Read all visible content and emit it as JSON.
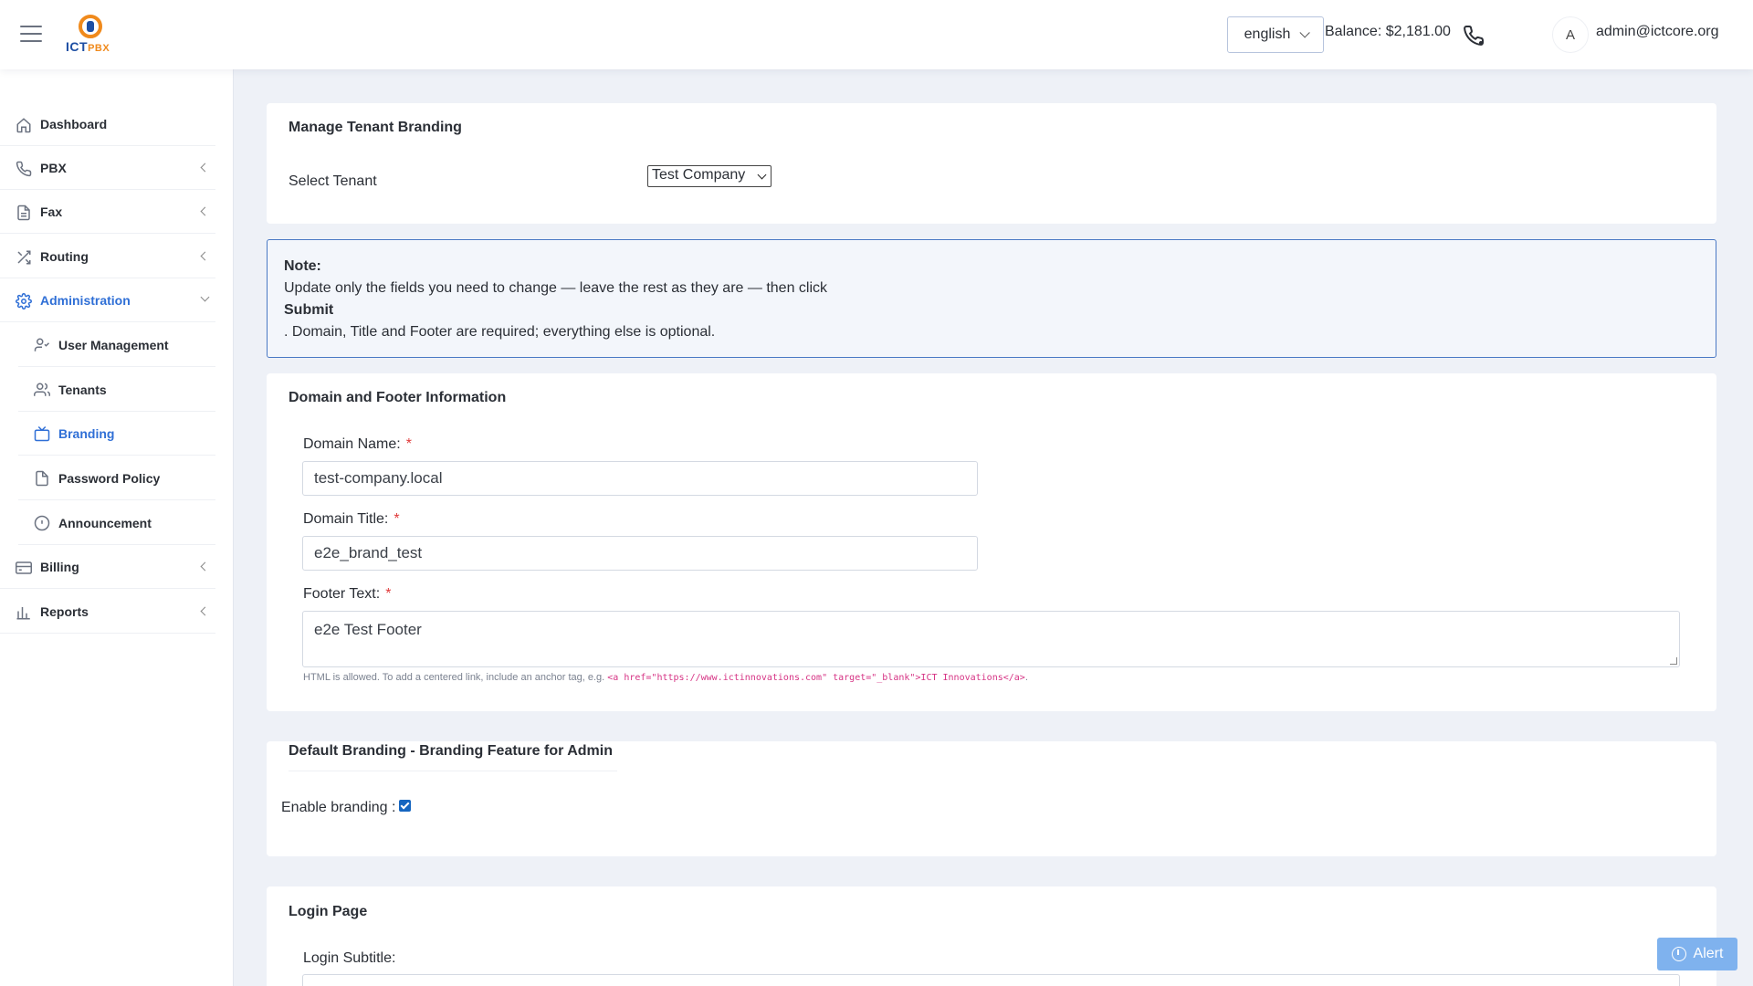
{
  "header": {
    "language": "english",
    "balance": "Balance: $2,181.00",
    "avatar_initial": "A",
    "user_email": "admin@ictcore.org",
    "logo_text": "ICT",
    "logo_suffix": "PBX"
  },
  "sidebar": {
    "items": [
      {
        "label": "Dashboard",
        "icon": "home-icon"
      },
      {
        "label": "PBX",
        "icon": "phone-icon"
      },
      {
        "label": "Fax",
        "icon": "document-icon"
      },
      {
        "label": "Routing",
        "icon": "shuffle-icon"
      },
      {
        "label": "Administration",
        "icon": "gear-icon"
      },
      {
        "label": "Billing",
        "icon": "credit-card-icon"
      },
      {
        "label": "Reports",
        "icon": "bar-chart-icon"
      }
    ],
    "admin_subitems": [
      {
        "label": "User Management",
        "icon": "user-check-icon"
      },
      {
        "label": "Tenants",
        "icon": "users-icon"
      },
      {
        "label": "Branding",
        "icon": "tv-icon"
      },
      {
        "label": "Password Policy",
        "icon": "file-icon"
      },
      {
        "label": "Announcement",
        "icon": "info-icon"
      }
    ]
  },
  "manage": {
    "title": "Manage Tenant Branding",
    "tenant_label": "Select Tenant",
    "tenant_value": "Test Company"
  },
  "note": {
    "heading": "Note:",
    "line1": "Update only the fields you need to change — leave the rest as they are — then click",
    "submit": "Submit",
    "line3": ". Domain, Title and Footer are required; everything else is optional."
  },
  "domain_section": {
    "title": "Domain and Footer Information",
    "domain_name_label": "Domain Name:",
    "domain_name_value": "test-company.local",
    "domain_title_label": "Domain Title:",
    "domain_title_value": "e2e_brand_test",
    "footer_label": "Footer Text:",
    "footer_value": "e2e Test Footer",
    "required_mark": "*",
    "help_prefix": "HTML is allowed. To add a centered link, include an anchor tag, e.g.",
    "help_code": "<a href=\"https://www.ictinnovations.com\" target=\"_blank\">ICT Innovations</a>",
    "help_suffix": "."
  },
  "default_branding": {
    "title": "Default Branding - Branding Feature for Admin",
    "enable_label": "Enable branding :",
    "enabled": true
  },
  "login_page": {
    "title": "Login Page",
    "subtitle_label": "Login Subtitle:"
  },
  "alert_button": {
    "label": "Alert"
  }
}
